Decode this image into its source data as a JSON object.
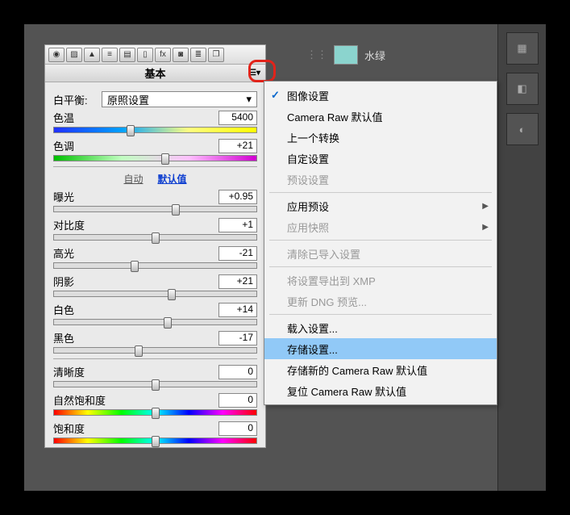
{
  "swatch": {
    "label": "水绿"
  },
  "panel": {
    "title": "基本",
    "wb_label": "白平衡:",
    "wb_value": "原照设置",
    "links": {
      "auto": "自动",
      "default": "默认值"
    },
    "sliders": {
      "temp": {
        "label": "色温",
        "value": "5400",
        "pos": 38
      },
      "tint": {
        "label": "色调",
        "value": "+21",
        "pos": 55
      },
      "exposure": {
        "label": "曝光",
        "value": "+0.95",
        "pos": 60
      },
      "contrast": {
        "label": "对比度",
        "value": "+1",
        "pos": 50
      },
      "highlights": {
        "label": "高光",
        "value": "-21",
        "pos": 40
      },
      "shadows": {
        "label": "阴影",
        "value": "+21",
        "pos": 58
      },
      "whites": {
        "label": "白色",
        "value": "+14",
        "pos": 56
      },
      "blacks": {
        "label": "黑色",
        "value": "-17",
        "pos": 42
      },
      "clarity": {
        "label": "清晰度",
        "value": "0",
        "pos": 50
      },
      "vibrance": {
        "label": "自然饱和度",
        "value": "0",
        "pos": 50
      },
      "saturation": {
        "label": "饱和度",
        "value": "0",
        "pos": 50
      }
    }
  },
  "menu": {
    "items": [
      {
        "label": "图像设置",
        "checked": true
      },
      {
        "label": "Camera Raw 默认值"
      },
      {
        "label": "上一个转换"
      },
      {
        "label": "自定设置"
      },
      {
        "label": "预设设置",
        "disabled": true
      },
      {
        "sep": true
      },
      {
        "label": "应用预设",
        "sub": true
      },
      {
        "label": "应用快照",
        "sub": true,
        "disabled": true
      },
      {
        "sep": true
      },
      {
        "label": "清除已导入设置",
        "disabled": true
      },
      {
        "sep": true
      },
      {
        "label": "将设置导出到 XMP",
        "disabled": true
      },
      {
        "label": "更新 DNG 预览...",
        "disabled": true
      },
      {
        "sep": true
      },
      {
        "label": "载入设置..."
      },
      {
        "label": "存储设置...",
        "hl": true
      },
      {
        "label": "存储新的 Camera Raw 默认值"
      },
      {
        "label": "复位 Camera Raw 默认值"
      }
    ]
  }
}
